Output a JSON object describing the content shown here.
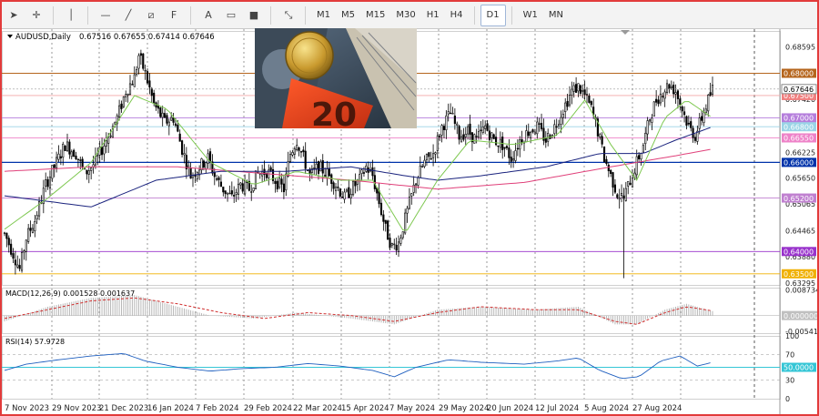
{
  "toolbar": {
    "tools": [
      {
        "name": "cursor-tool-icon",
        "glyph": "➤"
      },
      {
        "name": "crosshair-tool-icon",
        "glyph": "✛"
      },
      {
        "name": "vertical-line-tool-icon",
        "glyph": "│"
      },
      {
        "name": "horizontal-line-tool-icon",
        "glyph": "—"
      },
      {
        "name": "trendline-tool-icon",
        "glyph": "╱"
      },
      {
        "name": "channel-tool-icon",
        "glyph": "⧄"
      },
      {
        "name": "fibonacci-tool-icon",
        "glyph": "F"
      },
      {
        "name": "text-tool-icon",
        "glyph": "A"
      },
      {
        "name": "label-tool-icon",
        "glyph": "▭"
      },
      {
        "name": "rectangle-tool-icon",
        "glyph": "■"
      },
      {
        "name": "shapes-menu-icon",
        "glyph": "⤡"
      }
    ],
    "timeframes": [
      "M1",
      "M5",
      "M15",
      "M30",
      "H1",
      "H4",
      "D1",
      "W1",
      "MN"
    ],
    "active_timeframe": "D1"
  },
  "chart_data": [
    {
      "type": "candlestick",
      "symbol_title": "AUDUSD,Daily",
      "ohlc_label": "0.67516 0.67655 0.67414 0.67646",
      "ylim": [
        0.6325,
        0.6895
      ],
      "price_ticks": [
        "0.68595",
        "0.68040",
        "0.67420",
        "0.66840",
        "0.66225",
        "0.65650",
        "0.65065",
        "0.64465",
        "0.63880",
        "0.63295"
      ],
      "x_labels": [
        "7 Nov 2023",
        "29 Nov 2023",
        "21 Dec 2023",
        "16 Jan 2024",
        "7 Feb 2024",
        "29 Feb 2024",
        "22 Mar 2024",
        "15 Apr 2024",
        "7 May 2024",
        "29 May 2024",
        "20 Jun 2024",
        "12 Jul 2024",
        "5 Aug 2024",
        "27 Aug 2024"
      ],
      "levels": [
        {
          "price": 0.68,
          "label": "0.68000",
          "color": "#b5651d",
          "label_bg": "#b5651d"
        },
        {
          "price": 0.675,
          "label": "0.67500",
          "color": "#f3a7a7",
          "label_bg": "#f08080"
        },
        {
          "price": 0.67,
          "label": "0.67000",
          "color": "#b57edc",
          "label_bg": "#b57edc"
        },
        {
          "price": 0.668,
          "label": "0.66800",
          "color": "#9ad4e6",
          "label_bg": "#9ad4e6"
        },
        {
          "price": 0.6655,
          "label": "0.66550",
          "color": "#ee82c8",
          "label_bg": "#ee82c8"
        },
        {
          "price": 0.66,
          "label": "0.66000",
          "color": "#0033aa",
          "label_bg": "#0033aa"
        },
        {
          "price": 0.652,
          "label": "0.65200",
          "color": "#c080d0",
          "label_bg": "#c080d0"
        },
        {
          "price": 0.64,
          "label": "0.64000",
          "color": "#9933cc",
          "label_bg": "#9933cc"
        },
        {
          "price": 0.635,
          "label": "0.63500",
          "color": "#f0b000",
          "label_bg": "#f0b000"
        }
      ],
      "current_price_label": "0.67646",
      "path": [
        [
          0,
          0.644
        ],
        [
          4,
          0.6395
        ],
        [
          7,
          0.636
        ],
        [
          10,
          0.643
        ],
        [
          14,
          0.647
        ],
        [
          19,
          0.655
        ],
        [
          23,
          0.659
        ],
        [
          28,
          0.664
        ],
        [
          33,
          0.662
        ],
        [
          37,
          0.6575
        ],
        [
          42,
          0.66
        ],
        [
          47,
          0.665
        ],
        [
          52,
          0.67
        ],
        [
          56,
          0.676
        ],
        [
          60,
          0.679
        ],
        [
          62,
          0.684
        ],
        [
          65,
          0.68
        ],
        [
          69,
          0.673
        ],
        [
          74,
          0.669
        ],
        [
          78,
          0.67
        ],
        [
          82,
          0.663
        ],
        [
          86,
          0.657
        ],
        [
          90,
          0.659
        ],
        [
          94,
          0.661
        ],
        [
          97,
          0.657
        ],
        [
          101,
          0.654
        ],
        [
          105,
          0.652
        ],
        [
          109,
          0.655
        ],
        [
          113,
          0.654
        ],
        [
          117,
          0.6575
        ],
        [
          121,
          0.658
        ],
        [
          125,
          0.656
        ],
        [
          129,
          0.654
        ],
        [
          132,
          0.662
        ],
        [
          135,
          0.665
        ],
        [
          138,
          0.661
        ],
        [
          141,
          0.657
        ],
        [
          145,
          0.659
        ],
        [
          149,
          0.6575
        ],
        [
          153,
          0.655
        ],
        [
          157,
          0.652
        ],
        [
          160,
          0.654
        ],
        [
          164,
          0.656
        ],
        [
          167,
          0.659
        ],
        [
          170,
          0.657
        ],
        [
          173,
          0.651
        ],
        [
          176,
          0.645
        ],
        [
          179,
          0.641
        ],
        [
          182,
          0.642
        ],
        [
          186,
          0.649
        ],
        [
          190,
          0.656
        ],
        [
          194,
          0.66
        ],
        [
          198,
          0.662
        ],
        [
          202,
          0.668
        ],
        [
          206,
          0.671
        ],
        [
          210,
          0.666
        ],
        [
          214,
          0.667
        ],
        [
          218,
          0.665
        ],
        [
          222,
          0.668
        ],
        [
          226,
          0.665
        ],
        [
          230,
          0.664
        ],
        [
          234,
          0.661
        ],
        [
          238,
          0.665
        ],
        [
          242,
          0.667
        ],
        [
          246,
          0.668
        ],
        [
          250,
          0.665
        ],
        [
          254,
          0.668
        ],
        [
          258,
          0.672
        ],
        [
          262,
          0.676
        ],
        [
          265,
          0.677
        ],
        [
          268,
          0.675
        ],
        [
          271,
          0.672
        ],
        [
          274,
          0.667
        ],
        [
          277,
          0.661
        ],
        [
          280,
          0.657
        ],
        [
          283,
          0.653
        ],
        [
          286,
          0.652
        ],
        [
          289,
          0.656
        ],
        [
          292,
          0.66
        ],
        [
          295,
          0.664
        ],
        [
          298,
          0.67
        ],
        [
          301,
          0.674
        ],
        [
          304,
          0.676
        ],
        [
          307,
          0.6775
        ],
        [
          310,
          0.676
        ],
        [
          313,
          0.672
        ],
        [
          316,
          0.668
        ],
        [
          319,
          0.666
        ],
        [
          322,
          0.67
        ],
        [
          325,
          0.674
        ],
        [
          327,
          0.6765
        ]
      ],
      "candle_count": 328,
      "sma_fast": [
        [
          0,
          0.645
        ],
        [
          20,
          0.652
        ],
        [
          40,
          0.66
        ],
        [
          60,
          0.675
        ],
        [
          75,
          0.672
        ],
        [
          95,
          0.66
        ],
        [
          115,
          0.655
        ],
        [
          135,
          0.658
        ],
        [
          155,
          0.656
        ],
        [
          170,
          0.656
        ],
        [
          185,
          0.644
        ],
        [
          200,
          0.656
        ],
        [
          215,
          0.665
        ],
        [
          235,
          0.664
        ],
        [
          255,
          0.666
        ],
        [
          268,
          0.674
        ],
        [
          280,
          0.664
        ],
        [
          292,
          0.656
        ],
        [
          305,
          0.67
        ],
        [
          315,
          0.674
        ],
        [
          327,
          0.67
        ]
      ],
      "sma_mid": [
        [
          0,
          0.6525
        ],
        [
          40,
          0.65
        ],
        [
          70,
          0.656
        ],
        [
          100,
          0.658
        ],
        [
          130,
          0.658
        ],
        [
          160,
          0.659
        ],
        [
          185,
          0.657
        ],
        [
          200,
          0.656
        ],
        [
          220,
          0.657
        ],
        [
          250,
          0.659
        ],
        [
          275,
          0.662
        ],
        [
          295,
          0.662
        ],
        [
          310,
          0.665
        ],
        [
          327,
          0.668
        ]
      ],
      "sma_slow": [
        [
          0,
          0.658
        ],
        [
          40,
          0.659
        ],
        [
          80,
          0.659
        ],
        [
          120,
          0.6575
        ],
        [
          160,
          0.656
        ],
        [
          200,
          0.654
        ],
        [
          240,
          0.6555
        ],
        [
          280,
          0.659
        ],
        [
          310,
          0.6615
        ],
        [
          327,
          0.663
        ]
      ]
    },
    {
      "type": "macd",
      "label": "MACD(12,26,9) 0.001528 0.001637",
      "ylim": [
        -0.006,
        0.0095
      ],
      "price_ticks": [
        "0.008734",
        "0.000000",
        "-0.005412"
      ],
      "zero_label": "0.000000",
      "values": [
        [
          0,
          -0.002
        ],
        [
          20,
          0.003
        ],
        [
          40,
          0.006
        ],
        [
          60,
          0.007
        ],
        [
          75,
          0.004
        ],
        [
          95,
          0.0
        ],
        [
          115,
          -0.001
        ],
        [
          135,
          0.001
        ],
        [
          160,
          -0.001
        ],
        [
          180,
          -0.003
        ],
        [
          200,
          0.002
        ],
        [
          220,
          0.003
        ],
        [
          245,
          0.002
        ],
        [
          265,
          0.003
        ],
        [
          282,
          -0.003
        ],
        [
          292,
          -0.003
        ],
        [
          305,
          0.002
        ],
        [
          315,
          0.004
        ],
        [
          327,
          0.0015
        ]
      ],
      "signal": [
        [
          0,
          -0.001
        ],
        [
          20,
          0.002
        ],
        [
          40,
          0.005
        ],
        [
          60,
          0.006
        ],
        [
          80,
          0.004
        ],
        [
          100,
          0.001
        ],
        [
          120,
          -0.001
        ],
        [
          140,
          0.001
        ],
        [
          160,
          0.0
        ],
        [
          180,
          -0.002
        ],
        [
          200,
          0.001
        ],
        [
          220,
          0.003
        ],
        [
          245,
          0.002
        ],
        [
          265,
          0.002
        ],
        [
          282,
          -0.002
        ],
        [
          292,
          -0.003
        ],
        [
          305,
          0.001
        ],
        [
          315,
          0.003
        ],
        [
          327,
          0.0016
        ]
      ]
    },
    {
      "type": "rsi",
      "label": "RSI(14) 57.9728",
      "ylim": [
        0,
        100
      ],
      "price_ticks": [
        "100",
        "70",
        "50",
        "30",
        "0"
      ],
      "highlight_label": "50.0000",
      "values": [
        [
          0,
          45
        ],
        [
          10,
          55
        ],
        [
          25,
          62
        ],
        [
          40,
          68
        ],
        [
          55,
          72
        ],
        [
          65,
          60
        ],
        [
          80,
          50
        ],
        [
          95,
          44
        ],
        [
          110,
          48
        ],
        [
          125,
          50
        ],
        [
          140,
          56
        ],
        [
          155,
          52
        ],
        [
          170,
          45
        ],
        [
          180,
          35
        ],
        [
          190,
          50
        ],
        [
          205,
          62
        ],
        [
          220,
          58
        ],
        [
          240,
          55
        ],
        [
          255,
          60
        ],
        [
          265,
          65
        ],
        [
          275,
          45
        ],
        [
          285,
          32
        ],
        [
          293,
          35
        ],
        [
          303,
          60
        ],
        [
          312,
          68
        ],
        [
          320,
          52
        ],
        [
          327,
          58
        ]
      ]
    }
  ]
}
